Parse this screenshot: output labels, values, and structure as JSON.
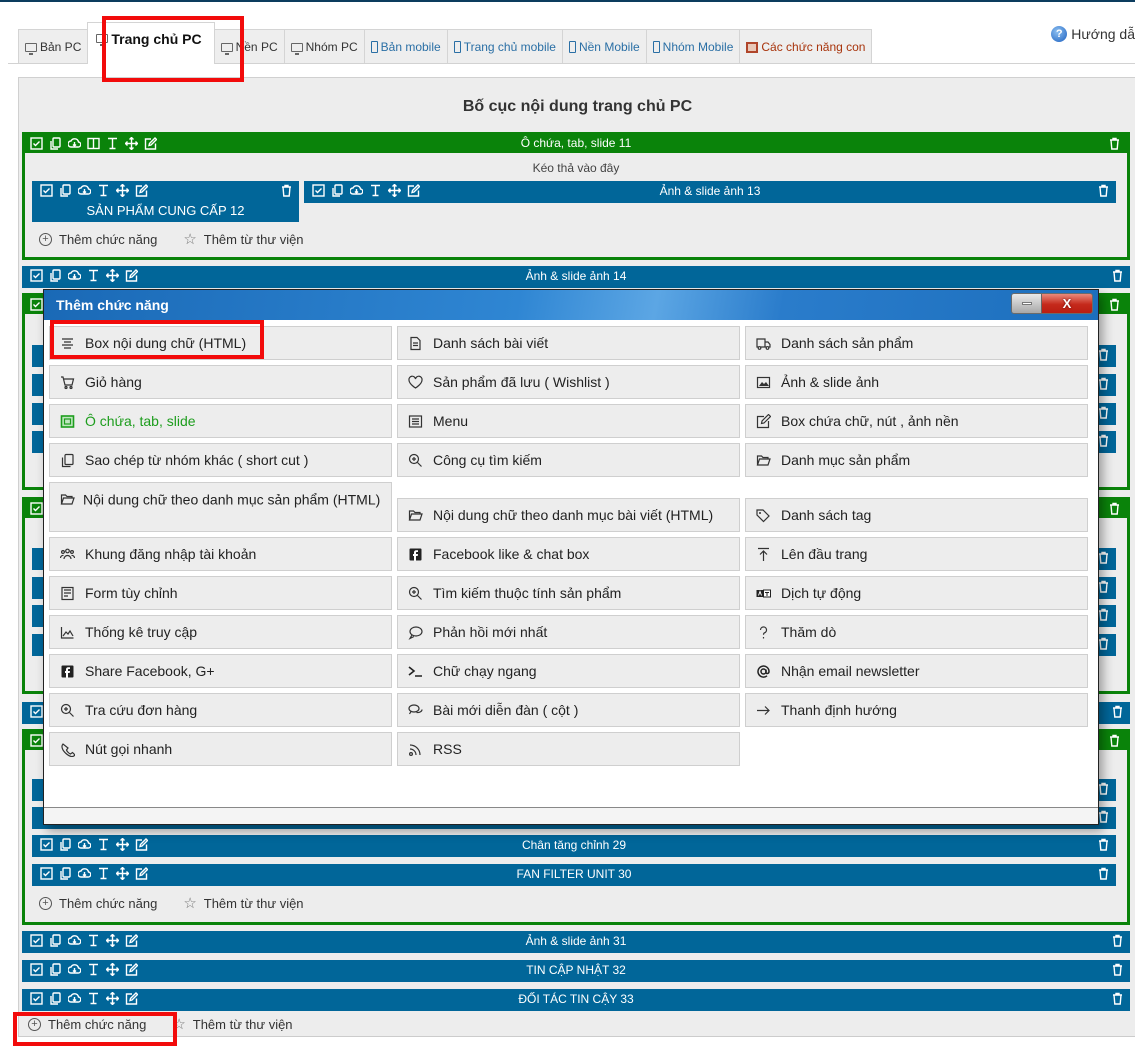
{
  "tabs": [
    {
      "label": "Bản PC",
      "kind": "pc",
      "icon": "monitor-icon"
    },
    {
      "label": "Trang chủ PC",
      "kind": "pc",
      "icon": "monitor-icon",
      "active": true
    },
    {
      "label": "Nền PC",
      "kind": "pc",
      "icon": "monitor-icon"
    },
    {
      "label": "Nhóm PC",
      "kind": "pc",
      "icon": "monitor-icon"
    },
    {
      "label": "Bản mobile",
      "kind": "mobile",
      "icon": "mobile-icon"
    },
    {
      "label": "Trang chủ mobile",
      "kind": "mobile",
      "icon": "mobile-icon"
    },
    {
      "label": "Nền Mobile",
      "kind": "mobile",
      "icon": "mobile-icon"
    },
    {
      "label": "Nhóm Mobile",
      "kind": "mobile",
      "icon": "mobile-icon"
    },
    {
      "label": "Các chức năng con",
      "kind": "sub",
      "icon": "subfunction-icon"
    }
  ],
  "help": {
    "label": "Hướng dẫ"
  },
  "panel": {
    "title": "Bố cục nội dung trang chủ PC",
    "container11": {
      "label": "Ô chứa, tab, slide 11",
      "drop_text": "Kéo thả vào đây"
    },
    "block12": {
      "label": "SẢN PHẨM CUNG CẤP 12"
    },
    "block13": {
      "label": "Ảnh & slide ảnh 13"
    },
    "block14": {
      "label": "Ảnh & slide ảnh 14"
    },
    "block29": {
      "label": "Chân tăng chỉnh 29"
    },
    "block30": {
      "label": "FAN FILTER UNIT 30"
    },
    "block31": {
      "label": "Ảnh & slide ảnh 31"
    },
    "block32": {
      "label": "TIN CẬP NHẬT 32"
    },
    "block33": {
      "label": "ĐỐI TÁC TIN CẬY 33"
    },
    "add_function": "Thêm chức năng",
    "add_from_library": "Thêm từ thư viện"
  },
  "colors": {
    "block_blue": "#016699",
    "container_green": "#0a830a",
    "highlight_red": "#f20b0b"
  },
  "modal": {
    "title": "Thêm chức năng",
    "columns": [
      [
        {
          "label": "Box nội dung chữ (HTML)",
          "icon": "align-lines-icon"
        },
        {
          "label": "Giỏ hàng",
          "icon": "cart-icon"
        },
        {
          "label": "Ô chứa, tab, slide",
          "icon": "container-icon",
          "green": true
        },
        {
          "label": "Sao chép từ nhóm khác ( short cut )",
          "icon": "copy-icon"
        },
        {
          "label": "Nội dung chữ theo danh mục sản phẩm (HTML)",
          "icon": "folder-open-icon",
          "tall": true
        },
        {
          "label": "Khung đăng nhập tài khoản",
          "icon": "users-icon"
        },
        {
          "label": "Form tùy chỉnh",
          "icon": "form-icon"
        },
        {
          "label": "Thống kê truy cập",
          "icon": "area-chart-icon"
        },
        {
          "label": "Share Facebook, G+",
          "icon": "facebook-icon"
        },
        {
          "label": "Tra cứu đơn hàng",
          "icon": "zoom-in-icon"
        },
        {
          "label": "Nút gọi nhanh",
          "icon": "phone-icon"
        }
      ],
      [
        {
          "label": "Danh sách bài viết",
          "icon": "document-icon"
        },
        {
          "label": "Sản phẩm đã lưu ( Wishlist )",
          "icon": "heart-icon"
        },
        {
          "label": "Menu",
          "icon": "list-icon"
        },
        {
          "label": "Công cụ tìm kiếm",
          "icon": "zoom-in-icon"
        },
        {
          "label": "Nội dung chữ theo danh mục bài viết (HTML)",
          "icon": "folder-open-icon"
        },
        {
          "label": "Facebook like & chat box",
          "icon": "facebook-icon"
        },
        {
          "label": "Tìm kiếm thuộc tính sản phẩm",
          "icon": "zoom-in-icon"
        },
        {
          "label": "Phản hồi mới nhất",
          "icon": "comment-icon"
        },
        {
          "label": "Chữ chạy ngang",
          "icon": "terminal-icon"
        },
        {
          "label": "Bài mới diễn đàn ( cột )",
          "icon": "comments-icon"
        },
        {
          "label": "RSS",
          "icon": "rss-icon"
        }
      ],
      [
        {
          "label": "Danh sách sản phẩm",
          "icon": "truck-icon"
        },
        {
          "label": "Ảnh & slide ảnh",
          "icon": "image-icon"
        },
        {
          "label": "Box chứa chữ, nút , ảnh nền",
          "icon": "edit-icon"
        },
        {
          "label": "Danh mục sản phẩm",
          "icon": "folder-open-icon"
        },
        {
          "label": "Danh sách tag",
          "icon": "tags-icon"
        },
        {
          "label": "Lên đầu trang",
          "icon": "arrow-up-icon"
        },
        {
          "label": "Dịch tự động",
          "icon": "translate-icon"
        },
        {
          "label": "Thăm dò",
          "icon": "question-icon"
        },
        {
          "label": "Nhận email newsletter",
          "icon": "at-icon"
        },
        {
          "label": "Thanh định hướng",
          "icon": "arrow-right-icon"
        }
      ]
    ]
  }
}
